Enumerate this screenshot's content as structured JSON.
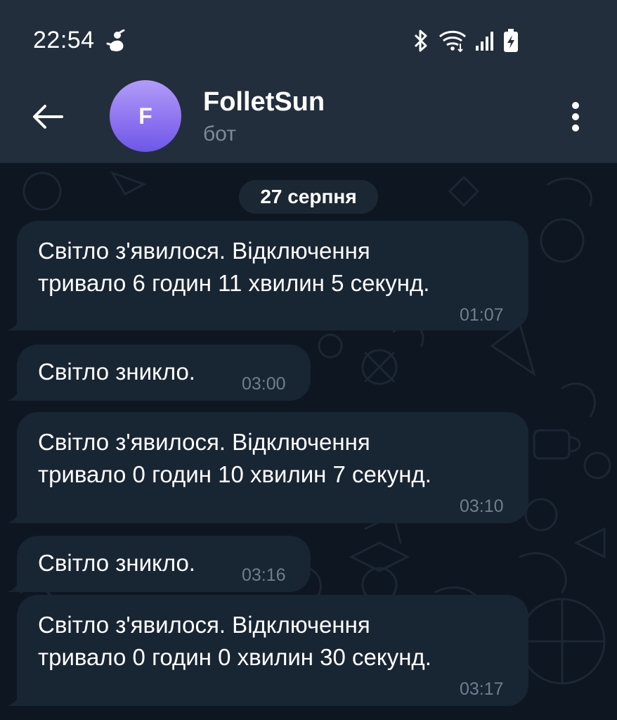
{
  "status_bar": {
    "time": "22:54",
    "icons": [
      "app-notification-icon",
      "bluetooth-icon",
      "wifi-icon",
      "signal-icon",
      "battery-charging-icon"
    ]
  },
  "header": {
    "avatar_letter": "F",
    "title": "FolletSun",
    "subtitle": "бот",
    "colors": {
      "header_bg": "#232e3c",
      "avatar_gradient_top": "#b19cf9",
      "avatar_gradient_bottom": "#6c57e8",
      "subtitle": "#7d8b99"
    }
  },
  "chat": {
    "date_label": "27 серпня",
    "colors": {
      "background": "#0e1621",
      "bubble": "#182533",
      "time": "#6d7f8f"
    },
    "messages": [
      {
        "line1": "Світло з'явилося. Відключення",
        "line2": "тривало 6 годин 11 хвилин 5 секунд.",
        "time": "01:07"
      },
      {
        "line1": "Світло зникло.",
        "time": "03:00"
      },
      {
        "line1": "Світло з'явилося. Відключення",
        "line2": "тривало 0 годин 10 хвилин 7 секунд.",
        "time": "03:10"
      },
      {
        "line1": "Світло зникло.",
        "time": "03:16"
      },
      {
        "line1": "Світло з'явилося. Відключення",
        "line2": "тривало 0 годин 0 хвилин 30 секунд.",
        "time": "03:17"
      }
    ]
  }
}
